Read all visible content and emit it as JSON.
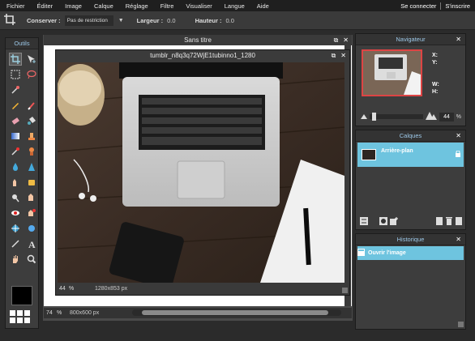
{
  "menubar": {
    "items": [
      "Fichier",
      "Éditer",
      "Image",
      "Calque",
      "Réglage",
      "Filtre",
      "Visualiser",
      "Langue",
      "Aide"
    ],
    "login": "Se connecter",
    "register": "S'inscrire"
  },
  "options": {
    "conserver_label": "Conserver :",
    "conserver_value": "Pas de restriction",
    "largeur_label": "Largeur :",
    "largeur_value": "0.0",
    "hauteur_label": "Hauteur :",
    "hauteur_value": "0.0"
  },
  "tools": {
    "title": "Outils"
  },
  "document": {
    "title": "Sans titre",
    "zoom": "74",
    "unit": "%",
    "size": "800x600 px"
  },
  "image_window": {
    "title": "tumblr_n8q3q72WjE1tubinno1_1280",
    "zoom": "44",
    "unit": "%",
    "size": "1280x853 px"
  },
  "navigator": {
    "title": "Navigateur",
    "x_label": "X:",
    "y_label": "Y:",
    "w_label": "W:",
    "h_label": "H:",
    "zoom": "44",
    "unit": "%"
  },
  "layers": {
    "title": "Calques",
    "items": [
      {
        "name": "Arrière-plan"
      }
    ]
  },
  "history": {
    "title": "Historique",
    "items": [
      {
        "name": "Ouvrir l'image"
      }
    ]
  },
  "colors": {
    "accent": "#6ec4df",
    "panel_title": "#9cc8e8"
  }
}
